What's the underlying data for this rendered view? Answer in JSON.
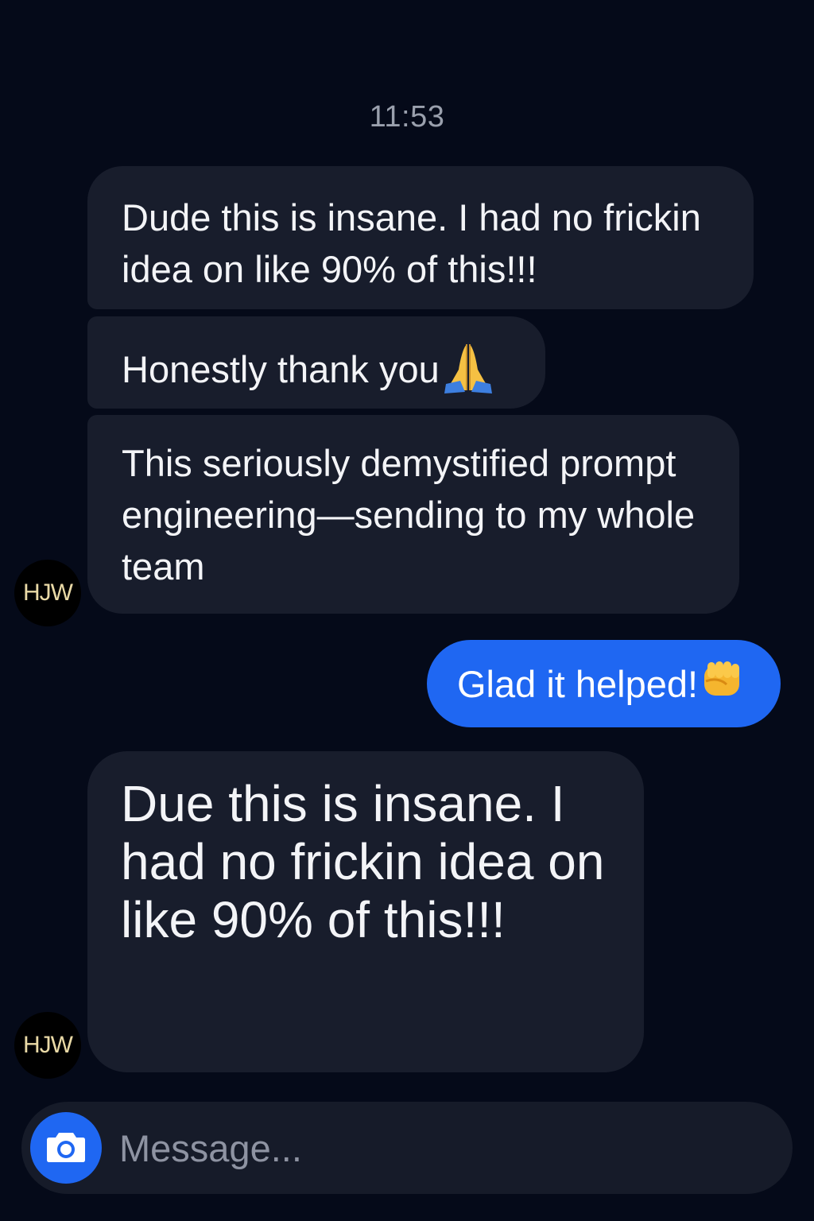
{
  "conversation": {
    "timestamp": "11:53",
    "messages": [
      {
        "sender": "HJW",
        "direction": "incoming",
        "text": "Dude this is insane. I had no frickin idea on like 90% of this!!!"
      },
      {
        "sender": "HJW",
        "direction": "incoming",
        "text": "Honestly thank you",
        "emoji": "folded-hands-icon"
      },
      {
        "sender": "HJW",
        "direction": "incoming",
        "text": "This seriously demystified prompt engineering—sending to my whole team"
      },
      {
        "sender": "me",
        "direction": "outgoing",
        "text": "Glad it helped!",
        "emoji": "raised-fist-icon"
      },
      {
        "sender": "HJW",
        "direction": "incoming",
        "text": "Due this is insane. I had no frickin idea on like 90% of this!!!"
      }
    ]
  },
  "avatars": [
    {
      "initials": "HJW"
    },
    {
      "initials": "HJW"
    }
  ],
  "composer": {
    "placeholder": "Message...",
    "camera_icon": "camera-icon"
  },
  "colors": {
    "background": "#050a19",
    "incoming_bubble": "#181d2c",
    "outgoing_bubble": "#1f67f2",
    "avatar_text": "#e9d9a6"
  }
}
